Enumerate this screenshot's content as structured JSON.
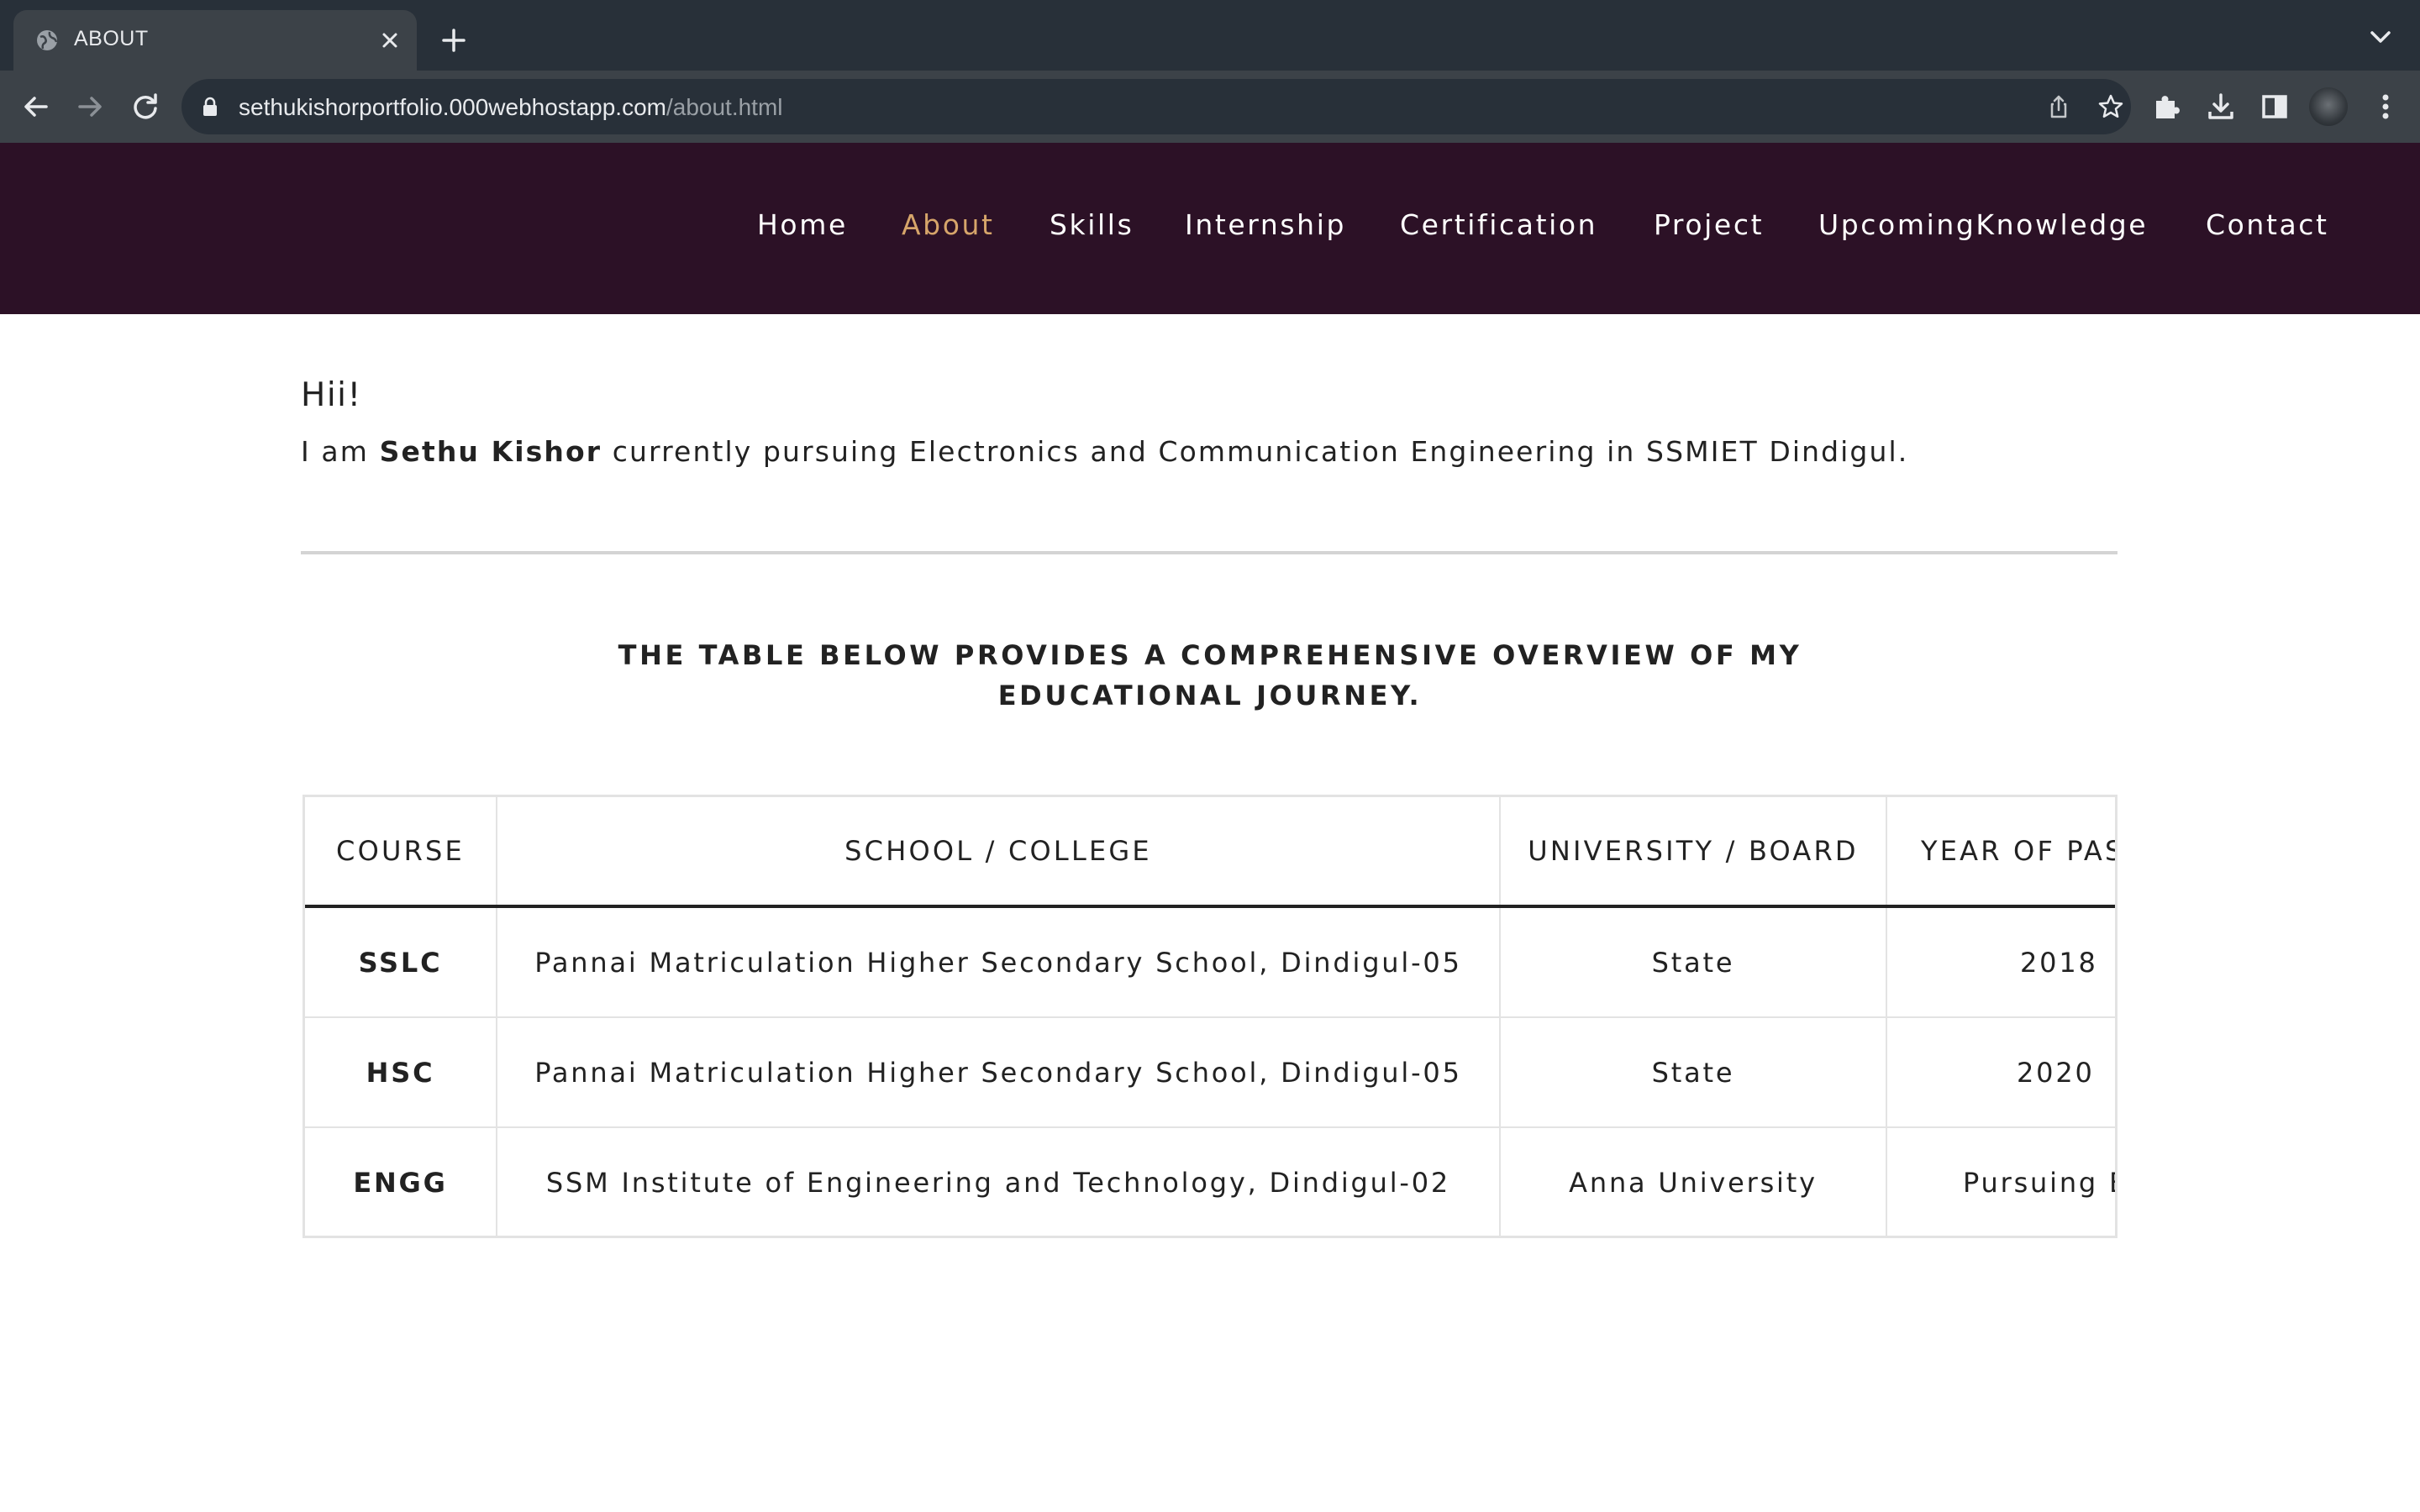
{
  "browser": {
    "tab_title": "ABOUT",
    "url_host": "sethukishorportfolio.000webhostapp.com",
    "url_path": "/about.html"
  },
  "site": {
    "nav": [
      {
        "label": "Home",
        "active": false
      },
      {
        "label": "About",
        "active": true
      },
      {
        "label": "Skills",
        "active": false
      },
      {
        "label": "Internship",
        "active": false
      },
      {
        "label": "Certification",
        "active": false
      },
      {
        "label": "Project",
        "active": false
      },
      {
        "label": "UpcomingKnowledge",
        "active": false
      },
      {
        "label": "Contact",
        "active": false
      }
    ],
    "colors": {
      "header_bg": "#2c1126",
      "active_link": "#d6a56a"
    }
  },
  "main": {
    "greeting": "Hii!",
    "intro_prefix": "I am ",
    "intro_name": "Sethu Kishor",
    "intro_suffix": " currently pursuing Electronics and Communication Engineering in SSMIET Dindigul.",
    "heading_line1": "THE TABLE BELOW PROVIDES A COMPREHENSIVE OVERVIEW OF MY",
    "heading_line2": "EDUCATIONAL JOURNEY."
  },
  "table": {
    "headers": [
      "COURSE",
      "SCHOOL / COLLEGE",
      "UNIVERSITY / BOARD",
      "YEAR OF PASSING"
    ],
    "rows": [
      [
        "SSLC",
        "Pannai Matriculation Higher Secondary School, Dindigul-05",
        "State",
        "2018"
      ],
      [
        "HSC",
        "Pannai Matriculation Higher Secondary School, Dindigul-05",
        "State",
        "2020"
      ],
      [
        "ENGG",
        "SSM Institute of Engineering and Technology, Dindigul-02",
        "Anna University",
        "Pursuing B.E"
      ]
    ]
  }
}
